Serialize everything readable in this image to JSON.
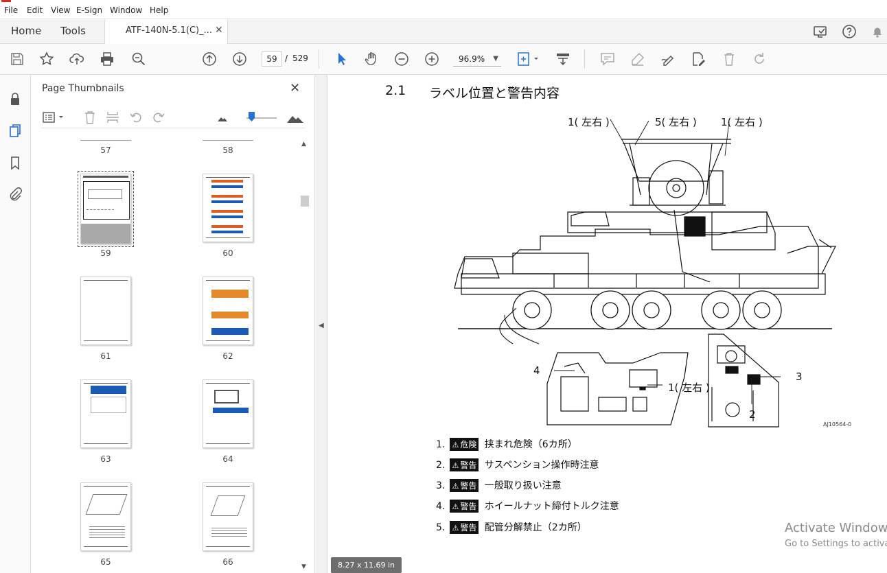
{
  "menu": [
    "File",
    "Edit",
    "View",
    "E-Sign",
    "Window",
    "Help"
  ],
  "tabs": {
    "home": "Home",
    "tools": "Tools",
    "document": "ATF-140N-5.1(C)_...",
    "close": "✕"
  },
  "toolbar": {
    "current_page": "59",
    "page_separator": "/",
    "total_pages": "529",
    "zoom": "96.9%"
  },
  "thumb_panel": {
    "title": "Page Thumbnails",
    "close": "✕",
    "pages": [
      "57",
      "58",
      "59",
      "60",
      "61",
      "62",
      "63",
      "64",
      "65",
      "66"
    ],
    "selected_page": "59"
  },
  "document": {
    "section_number": "2.1",
    "section_title": "ラベル位置と警告内容",
    "figure_callouts": {
      "top_left": "1( 左右 )",
      "top_mid": "5( 左右 )",
      "top_right": "1( 左右 )",
      "cab_num": "4",
      "cab_side": "1( 左右 )",
      "panel_3": "3",
      "panel_2": "2"
    },
    "figure_code": "AJ10564-0",
    "labels": [
      {
        "num": "1.",
        "badge": "危険",
        "text": "挟まれ危険（6カ所）"
      },
      {
        "num": "2.",
        "badge": "警告",
        "text": "サスペンション操作時注意"
      },
      {
        "num": "3.",
        "badge": "警告",
        "text": "一般取り扱い注意"
      },
      {
        "num": "4.",
        "badge": "警告",
        "text": "ホイールナット締付トルク注意"
      },
      {
        "num": "5.",
        "badge": "警告",
        "text": "配管分解禁止（2カ所）"
      }
    ],
    "warning_triangle": "⚠"
  },
  "status": {
    "page_size": "8.27 x 11.69 in"
  },
  "watermark": {
    "line1": "Activate Windows",
    "line2": "Go to Settings to activate Windows."
  },
  "colors": {
    "accent": "#2670d8",
    "badge_bg": "#111111",
    "panel_bg": "#fafafa"
  }
}
